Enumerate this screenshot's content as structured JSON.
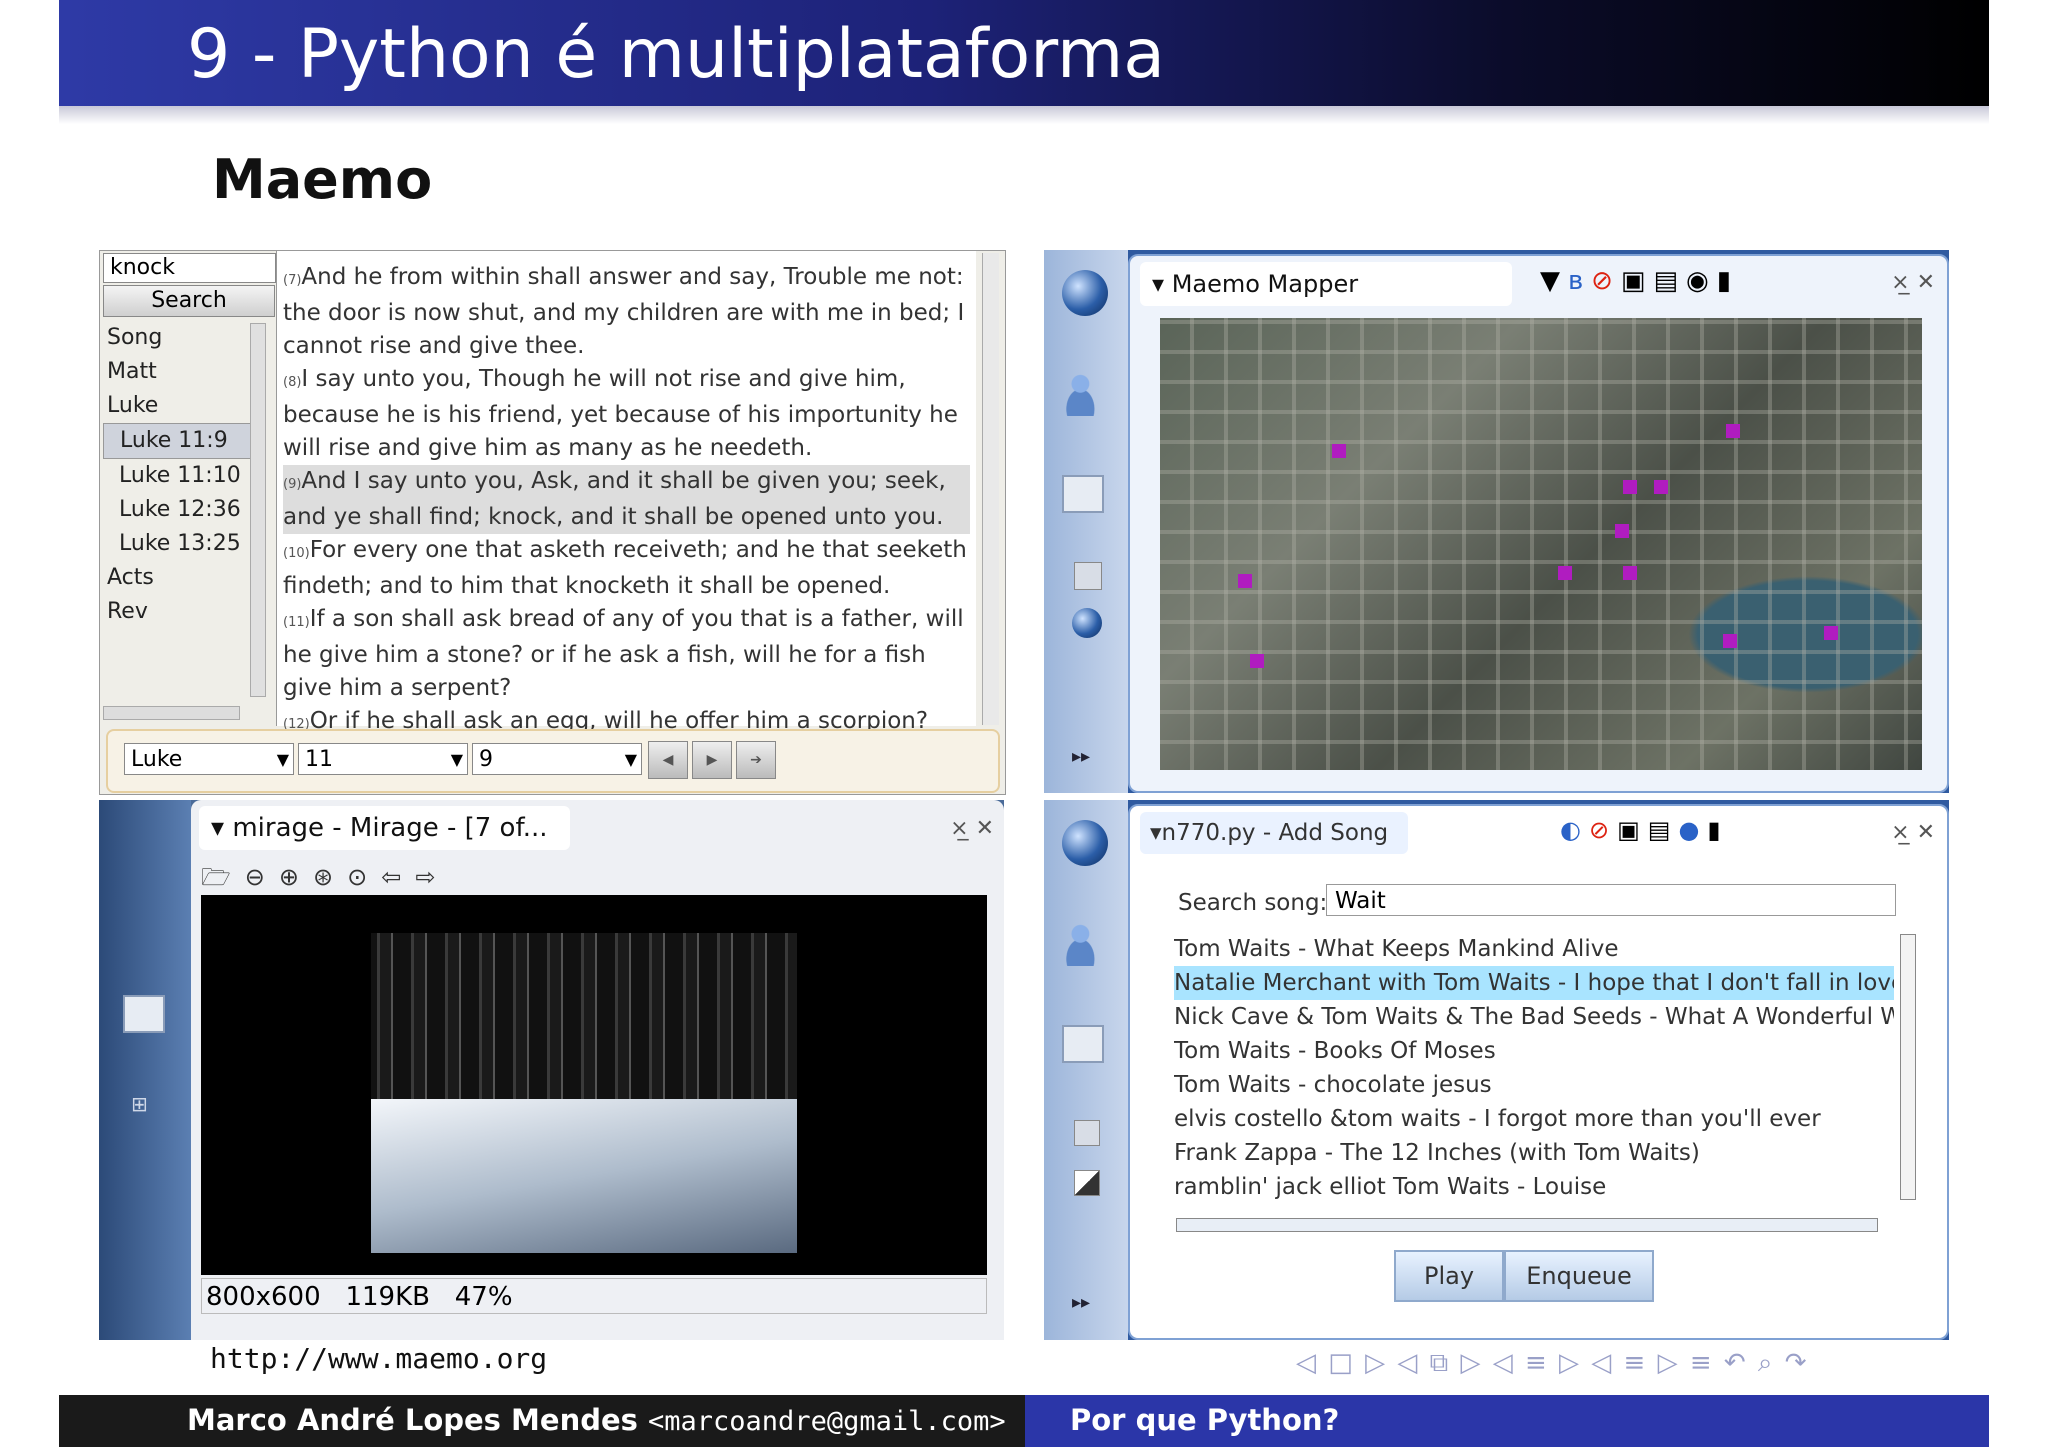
{
  "slide": {
    "title": "9 - Python é multiplataforma",
    "section": "Maemo",
    "url": "http://www.maemo.org",
    "footer_author": "Marco André Lopes Mendes",
    "footer_email": "<marcoandre@gmail.com>",
    "footer_talk": "Por que Python?",
    "nav_symbols": "◁ □ ▷ ◁ ⧉ ▷ ◁ ≡ ▷ ◁ ≡ ▷   ≡   ↶ ⌕ ↷"
  },
  "bible": {
    "search_value": "knock",
    "search_button": "Search",
    "books": [
      "Song",
      "Matt",
      "Luke",
      "Luke 11:9",
      "Luke 11:10",
      "Luke 12:36",
      "Luke 13:25",
      "Acts",
      "Rev"
    ],
    "selected": "Luke 11:9",
    "verses": [
      {
        "num": "(7)",
        "text": "And he from within shall answer and say, Trouble me not: the door is now shut, and my children are with me in bed; I cannot rise and give thee."
      },
      {
        "num": "(8)",
        "text": "I say unto you, Though he will not rise and give him, because he is his friend, yet because of his importunity he will rise and give him as many as he needeth."
      },
      {
        "num": "(9)",
        "text": "And I say unto you, Ask, and it shall be given you; seek, and ye shall find; knock, and it shall be opened unto you."
      },
      {
        "num": "(10)",
        "text": "For every one that asketh receiveth; and he that seeketh findeth; and to him that knocketh it shall be opened."
      },
      {
        "num": "(11)",
        "text": "If a son shall ask bread of any of you that is a father, will he give him a stone? or if he ask a fish, will he for a fish give him a serpent?"
      },
      {
        "num": "(12)",
        "text": "Or if he shall ask an egg, will he offer him a scorpion?"
      }
    ],
    "book_combo": "Luke",
    "chapter_combo": "11",
    "verse_combo": "9"
  },
  "mapper": {
    "title": "Maemo Mapper"
  },
  "mirage": {
    "title": "mirage - Mirage - [7 of...",
    "status_resolution": "800x600",
    "status_size": "119KB",
    "status_zoom": "47%"
  },
  "addsong": {
    "title": "n770.py - Add Song",
    "search_label": "Search song:",
    "search_value": "Wait",
    "songs": [
      "Tom Waits - What Keeps Mankind Alive",
      "Natalie Merchant with Tom Waits - I hope that I don't fall in love w",
      "Nick Cave & Tom Waits & The Bad Seeds - What A Wonderful Worl",
      "Tom Waits - Books Of Moses",
      "Tom Waits - chocolate jesus",
      "elvis costello &tom waits - I forgot more than you'll ever",
      "Frank Zappa - The 12 Inches (with Tom Waits)",
      "ramblin' jack elliot Tom Waits - Louise"
    ],
    "selected_index": 1,
    "play_button": "Play",
    "enqueue_button": "Enqueue"
  }
}
